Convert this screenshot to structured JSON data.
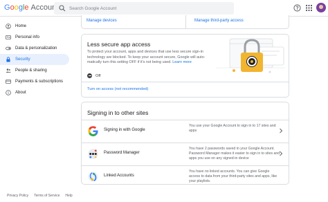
{
  "header": {
    "logo_google": [
      "G",
      "o",
      "o",
      "g",
      "l",
      "e"
    ],
    "logo_account": "Account",
    "search_placeholder": "Search Google Account"
  },
  "sidebar": {
    "items": [
      {
        "label": "Home",
        "icon": "home-icon"
      },
      {
        "label": "Personal info",
        "icon": "personal-info-icon"
      },
      {
        "label": "Data & personalization",
        "icon": "toggle-icon"
      },
      {
        "label": "Security",
        "icon": "lock-icon",
        "active": true
      },
      {
        "label": "People & sharing",
        "icon": "people-icon"
      },
      {
        "label": "Payments & subscriptions",
        "icon": "credit-card-icon"
      },
      {
        "label": "About",
        "icon": "info-icon"
      }
    ]
  },
  "top_cards": {
    "left_link": "Manage devices",
    "right_link": "Manage third-party access"
  },
  "less_secure": {
    "title": "Less secure app access",
    "description": "To protect your account, apps and devices that use less secure sign-in technology are blocked. To keep your account secure, Google will auto-matically turn this setting OFF if it's not being used.",
    "learn_more": "Learn more",
    "status": "Off",
    "action_link": "Turn on access (not recommended)"
  },
  "signin": {
    "title": "Signing in to other sites",
    "rows": [
      {
        "title": "Signing in with Google",
        "description": "You use your Google Account to sign in to 17 sites and apps",
        "icon": "google-g-icon"
      },
      {
        "title": "Password Manager",
        "description": "You have 2 passwords saved in your Google Account. Password Manager makes it easier to sign in to sites and apps you use on any signed-in device",
        "icon": "password-manager-icon"
      },
      {
        "title": "Linked Accounts",
        "description": "You have no linked accounts. You can give Google access to data from your third-party sites and apps, like your playlists.",
        "icon": "linked-accounts-icon"
      }
    ]
  },
  "footer": {
    "links": [
      "Privacy Policy",
      "Terms of Service",
      "Help"
    ]
  },
  "colors": {
    "accent": "#1a73e8",
    "active_bg": "#e8f0fe",
    "lock_gold": "#f2b530"
  }
}
